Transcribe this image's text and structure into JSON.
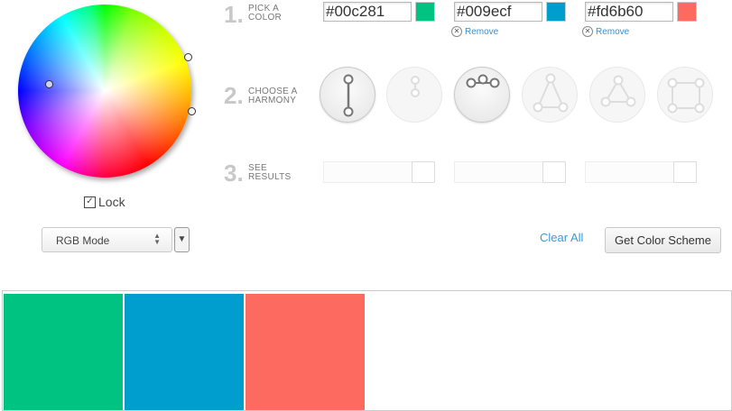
{
  "wheel": {
    "lock_label": "Lock",
    "lock_checked": true,
    "markers": [
      "primary-marker",
      "secondary-marker",
      "tertiary-marker"
    ]
  },
  "mode": {
    "label": "RGB Mode"
  },
  "steps": [
    {
      "number": "1.",
      "line1": "PICK A",
      "line2": "COLOR"
    },
    {
      "number": "2.",
      "line1": "CHOOSE A",
      "line2": "HARMONY"
    },
    {
      "number": "3.",
      "line1": "SEE",
      "line2": "RESULTS"
    }
  ],
  "colors": [
    {
      "hex": "#00c281",
      "swatch": "#00c281",
      "remove": ""
    },
    {
      "hex": "#009ecf",
      "swatch": "#009ecf",
      "remove": "Remove"
    },
    {
      "hex": "#fd6b60",
      "swatch": "#fd6b60",
      "remove": "Remove"
    }
  ],
  "harmonies": [
    {
      "name": "complementary",
      "active": true
    },
    {
      "name": "monochromatic",
      "active": false
    },
    {
      "name": "analogous",
      "active": true
    },
    {
      "name": "triadic",
      "active": false
    },
    {
      "name": "split-complementary",
      "active": false
    },
    {
      "name": "tetradic",
      "active": false
    }
  ],
  "actions": {
    "clear_all": "Clear All",
    "get_scheme": "Get Color Scheme"
  },
  "results": {
    "swatches": [
      "#00c281",
      "#009ecf",
      "#fd6b60"
    ]
  }
}
